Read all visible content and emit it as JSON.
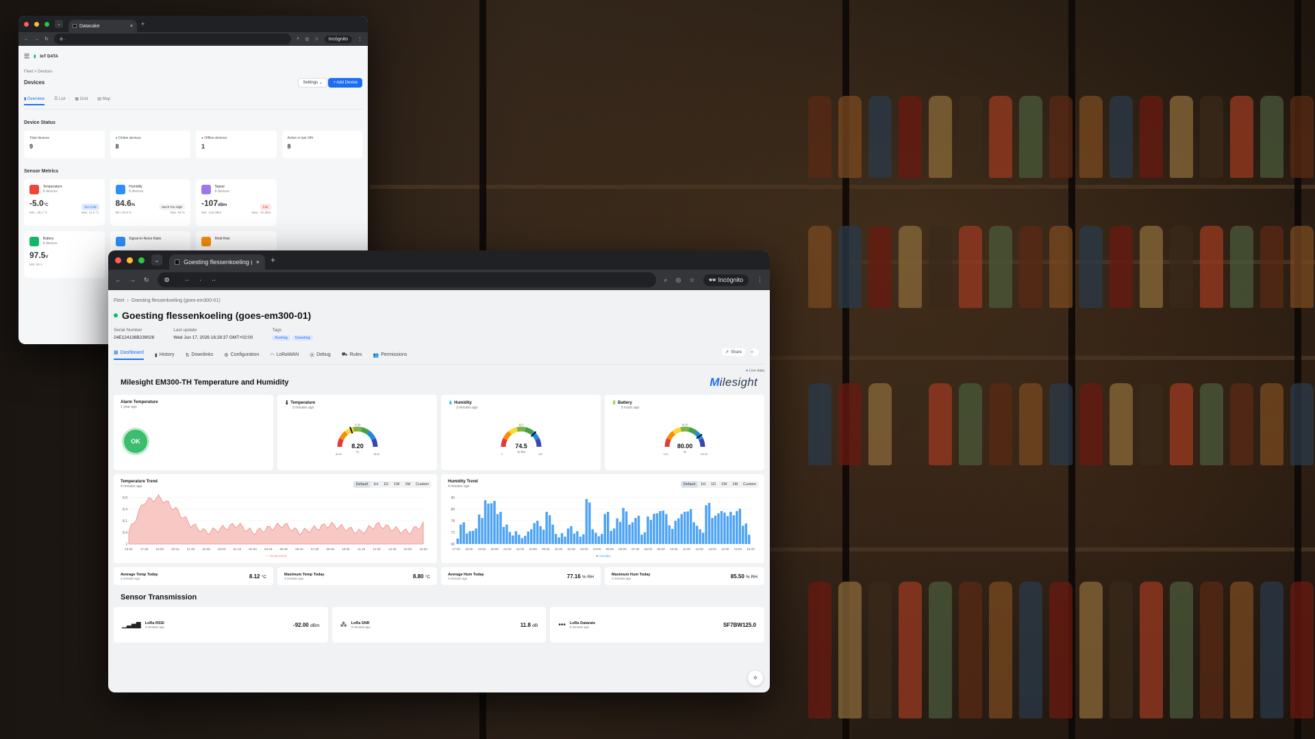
{
  "window1": {
    "tab_title": "Datacake",
    "incognito": "Incógnito",
    "logo": "IoT DATA",
    "breadcrumb": "Fleet  >  Devices",
    "title": "Devices",
    "settings_label": "Settings",
    "add_label": "+ Add Device",
    "tabs": [
      "Overview",
      "List",
      "Grid",
      "Map"
    ],
    "device_status_title": "Device Status",
    "stats": [
      {
        "label": "Total devices",
        "value": "9"
      },
      {
        "label": "Online devices",
        "value": "8"
      },
      {
        "label": "Offline devices",
        "value": "1"
      },
      {
        "label": "Active in last 24h",
        "value": "8"
      }
    ],
    "sensor_metrics_title": "Sensor Metrics",
    "metrics": [
      {
        "name": "Temperature",
        "sub": "8 devices",
        "value": "-5.0",
        "unit": "°C",
        "tag": "Too Cold",
        "min": "Min: -28.4 °C",
        "max": "Max: 11.0 °C",
        "color": "#f04438"
      },
      {
        "name": "Humidity",
        "sub": "8 devices",
        "value": "84.6",
        "unit": "%",
        "tag": "Much Too High",
        "min": "Min: 63.9 %",
        "max": "Max: 99 %",
        "color": "#2e90fa"
      },
      {
        "name": "Signal",
        "sub": "8 devices",
        "value": "-107",
        "unit": "dBm",
        "tag": "Fair",
        "min": "Min: -128 dBm",
        "max": "Max: -75 dBm",
        "color": "#9e77ed"
      },
      {
        "name": "Battery",
        "sub": "8 devices",
        "value": "97.5",
        "unit": "V",
        "min": "Min: 93 V",
        "color": "#12b76a"
      },
      {
        "name": "Signal-to-Noise Ratio",
        "color": "#2e90fa"
      },
      {
        "name": "Mold Risk",
        "color": "#f79009"
      }
    ]
  },
  "window2": {
    "tab_title": "Goesting flessenkoeling (goe",
    "incognito": "Incógnito",
    "breadcrumb_root": "Fleet",
    "breadcrumb_leaf": "Goesting flessenkoeling (goes-em300-01)",
    "device_title": "Goesting flessenkoeling (goes-em300-01)",
    "serial_label": "Serial Number",
    "serial_value": "24E124136B239026",
    "last_update_label": "Last update",
    "last_update_value": "Wed Jun 17, 2026 16:28:37 GMT+02:00",
    "tags_label": "Tags",
    "tags": [
      "Koeling",
      "Goesting"
    ],
    "tabs": [
      "Dashboard",
      "History",
      "Downlinks",
      "Configuration",
      "LoRaWAN",
      "Debug",
      "Rules",
      "Permissions"
    ],
    "share_label": "Share",
    "live_label": "Live data",
    "widget_title": "Milesight EM300-TH Temperature and Humidity",
    "brand": "Milesight",
    "alarm": {
      "title": "Alarm Temperature",
      "time": "1 year ago",
      "state": "OK"
    },
    "gauges": [
      {
        "title": "Temperature",
        "time": "3 minutes ago",
        "value": "8.20",
        "unit": "°C",
        "min": "-40.00",
        "max": "85.00",
        "mid": "12.50",
        "fraction": 0.385
      },
      {
        "title": "Humidity",
        "time": "3 minutes ago",
        "value": "74.5",
        "unit": "% RH",
        "min": "0",
        "max": "100",
        "mid": "50.0",
        "fraction": 0.745
      },
      {
        "title": "Battery",
        "time": "5 hours ago",
        "value": "80.00",
        "unit": "%",
        "min": "0.00",
        "max": "100.00",
        "mid": "50.00",
        "fraction": 0.8
      }
    ],
    "temp_trend": {
      "title": "Temperature Trend",
      "time": "4 minutes ago",
      "ranges": [
        "Default",
        "1H",
        "1D",
        "1W",
        "1M",
        "Custom"
      ],
      "legend": "Temperature"
    },
    "hum_trend": {
      "title": "Humidity Trend",
      "time": "4 minutes ago",
      "ranges": [
        "Default",
        "1H",
        "1D",
        "1W",
        "1M",
        "Custom"
      ],
      "legend": "Humidity"
    },
    "summary": [
      {
        "label": "Average Temp Today",
        "time": "3 minutes ago",
        "value": "8.12",
        "unit": "°C"
      },
      {
        "label": "Maximum Temp Today",
        "time": "3 minutes ago",
        "value": "8.80",
        "unit": "°C"
      },
      {
        "label": "Average Hum Today",
        "time": "3 minutes ago",
        "value": "77.16",
        "unit": "% RH"
      },
      {
        "label": "Maximum Hum Today",
        "time": "3 minutes ago",
        "value": "85.50",
        "unit": "% RH"
      }
    ],
    "transmission_title": "Sensor Transmission",
    "transmission": [
      {
        "label": "LoRa RSSI",
        "time": "3 minutes ago",
        "value": "-92.00",
        "unit": "dBm"
      },
      {
        "label": "LoRa SNR",
        "time": "3 minutes ago",
        "value": "11.8",
        "unit": "dB"
      },
      {
        "label": "LoRa Datarate",
        "time": "3 minutes ago",
        "value": "SF7BW125.0",
        "unit": ""
      }
    ]
  },
  "chart_data": [
    {
      "type": "area",
      "title": "Temperature Trend",
      "x": [
        "16:30",
        "17:45",
        "19:00",
        "20:15",
        "21:30",
        "22:45",
        "00:00",
        "01:15",
        "02:30",
        "03:45",
        "05:00",
        "06:15",
        "07:30",
        "08:45",
        "10:00",
        "11:15",
        "12:30",
        "13:45",
        "15:00",
        "16:30"
      ],
      "series": [
        {
          "name": "Temperature",
          "values": [
            8.1,
            8.9,
            9.0,
            8.7,
            8.3,
            8.1,
            8.2,
            8.3,
            8.1,
            8.2,
            8.3,
            8.1,
            8.2,
            8.3,
            8.2,
            8.1,
            8.3,
            8.2,
            8.1,
            8.3
          ]
        }
      ],
      "y_ticks": [
        "2",
        "8.4",
        "8.1",
        "8.4",
        "8.8"
      ],
      "ylim": [
        7.8,
        9.0
      ]
    },
    {
      "type": "bar",
      "title": "Humidity Trend",
      "x": [
        "17:00",
        "18:00",
        "19:00",
        "20:00",
        "21:00",
        "22:00",
        "23:00",
        "00:00",
        "01:00",
        "02:00",
        "03:00",
        "04:00",
        "05:00",
        "06:00",
        "07:00",
        "08:00",
        "09:00",
        "10:00",
        "11:00",
        "12:00",
        "13:00",
        "14:00",
        "15:00",
        "16:30"
      ],
      "series": [
        {
          "name": "Humidity",
          "values": [
            70,
            76,
            72,
            74,
            80,
            88,
            87,
            82,
            76,
            71,
            72,
            69,
            73,
            78,
            74,
            82,
            76,
            70,
            71,
            74,
            72,
            71,
            88,
            73,
            70,
            82,
            74,
            78,
            84,
            76,
            80,
            72,
            79,
            81,
            83,
            82,
            75,
            78,
            82,
            84,
            76,
            73,
            86,
            80,
            83,
            81,
            82,
            83,
            76,
            72
          ]
        }
      ],
      "y_ticks": [
        "66",
        "72",
        "78",
        "84",
        "90"
      ],
      "ylim": [
        66,
        90
      ]
    }
  ]
}
